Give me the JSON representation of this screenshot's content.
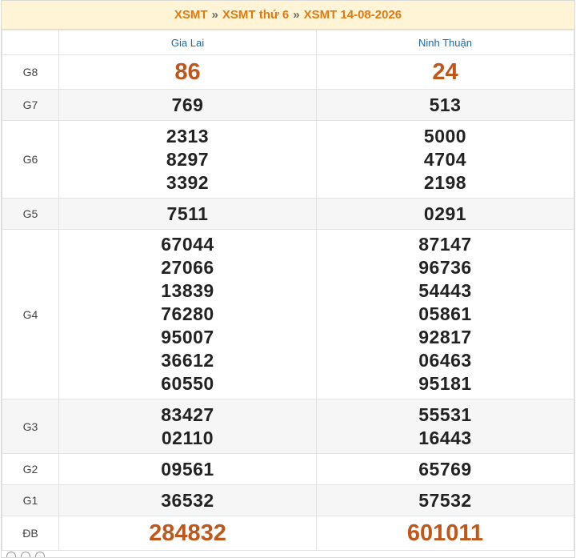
{
  "breadcrumb": {
    "items": [
      "XSMT",
      "XSMT thứ 6",
      "XSMT 14-08-2026"
    ],
    "separator": "»"
  },
  "columns": [
    "Gia Lai",
    "Ninh Thuận"
  ],
  "rows": [
    {
      "label": "G8",
      "values": [
        [
          "86"
        ],
        [
          "24"
        ]
      ]
    },
    {
      "label": "G7",
      "values": [
        [
          "769"
        ],
        [
          "513"
        ]
      ]
    },
    {
      "label": "G6",
      "values": [
        [
          "2313",
          "8297",
          "3392"
        ],
        [
          "5000",
          "4704",
          "2198"
        ]
      ]
    },
    {
      "label": "G5",
      "values": [
        [
          "7511"
        ],
        [
          "0291"
        ]
      ]
    },
    {
      "label": "G4",
      "values": [
        [
          "67044",
          "27066",
          "13839",
          "76280",
          "95007",
          "36612",
          "60550"
        ],
        [
          "87147",
          "96736",
          "54443",
          "05861",
          "92817",
          "06463",
          "95181"
        ]
      ]
    },
    {
      "label": "G3",
      "values": [
        [
          "83427",
          "02110"
        ],
        [
          "55531",
          "16443"
        ]
      ]
    },
    {
      "label": "G2",
      "values": [
        [
          "09561"
        ],
        [
          "65769"
        ]
      ]
    },
    {
      "label": "G1",
      "values": [
        [
          "36532"
        ],
        [
          "57532"
        ]
      ]
    },
    {
      "label": "ĐB",
      "values": [
        [
          "284832"
        ],
        [
          "601011"
        ]
      ]
    }
  ],
  "colors": {
    "accent": "#e07a10",
    "special": "#c0571a",
    "province": "#1a6aa8",
    "title_bg": "#fff4d6"
  }
}
